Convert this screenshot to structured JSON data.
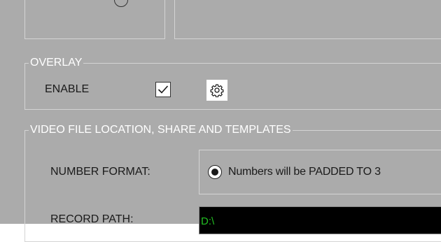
{
  "overlay": {
    "group_title": "OVERLAY",
    "enable_label": "ENABLE",
    "enable_checked": true,
    "settings_icon": "gear-icon"
  },
  "video": {
    "group_title": "VIDEO FILE LOCATION, SHARE AND TEMPLATES",
    "number_format_label": "NUMBER FORMAT:",
    "number_format_option": "Numbers will be PADDED TO 3",
    "number_format_selected": true,
    "record_path_label": "RECORD PATH:",
    "record_path_value": "D:\\"
  },
  "colors": {
    "panel_bg": "#ababab",
    "group_title": "#ffffff",
    "path_bg": "#000000",
    "path_text": "#22c022"
  }
}
